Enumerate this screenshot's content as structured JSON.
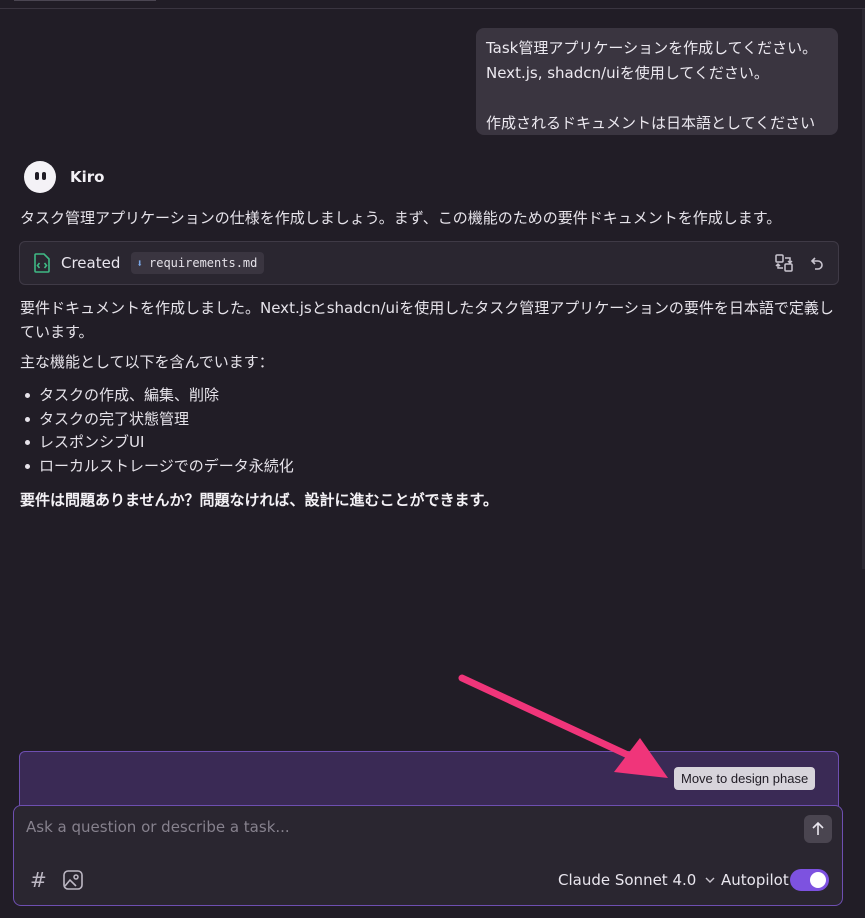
{
  "user_message": {
    "line1": "Task管理アプリケーションを作成してください。",
    "line2": "Next.js, shadcn/uiを使用してください。",
    "line3": "作成されるドキュメントは日本語としてください"
  },
  "agent": {
    "name": "Kiro",
    "intro": "タスク管理アプリケーションの仕様を作成しましょう。まず、この機能のための要件ドキュメントを作成します。",
    "created_card": {
      "label": "Created",
      "file_name": "requirements.md",
      "file_icon": "file-code-icon",
      "actions": [
        "compare-icon",
        "undo-icon"
      ]
    },
    "summary": "要件ドキュメントを作成しました。Next.jsとshadcn/uiを使用したタスク管理アプリケーションの要件を日本語で定義しています。",
    "features_heading": "主な機能として以下を含んでいます：",
    "features": [
      "タスクの作成、編集、削除",
      "タスクの完了状態管理",
      "レスポンシブUI",
      "ローカルストレージでのデータ永続化"
    ],
    "question": "要件は問題ありませんか？問題なければ、設計に進むことができます。"
  },
  "suggestion": {
    "button_label": "Move to design phase"
  },
  "composer": {
    "placeholder": "Ask a question or describe a task...",
    "model": "Claude Sonnet 4.0",
    "autopilot_label": "Autopilot",
    "autopilot_on": true
  },
  "colors": {
    "background": "#211d26",
    "accent": "#7d52e0",
    "suggestion_bg": "#3a2a55",
    "annotation_arrow": "#f0357a"
  }
}
